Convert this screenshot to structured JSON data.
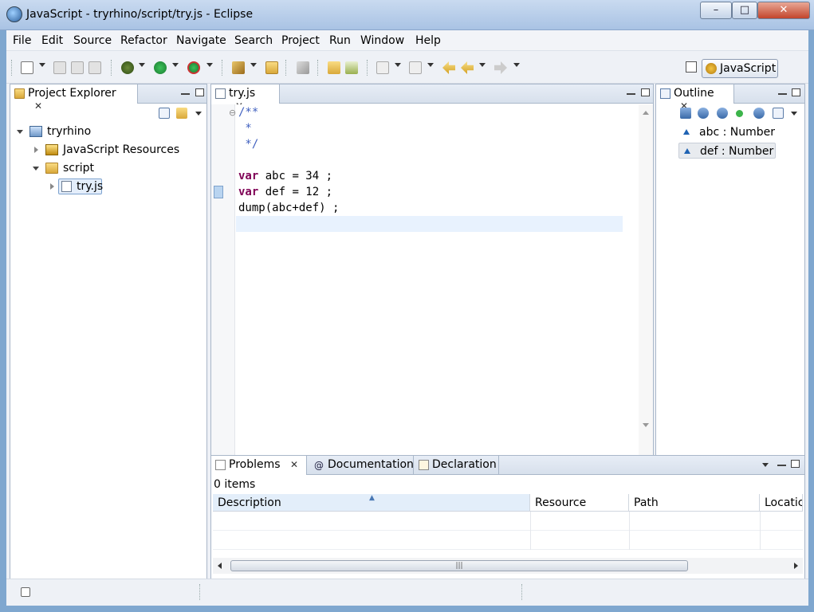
{
  "window": {
    "title": "JavaScript - tryrhino/script/try.js - Eclipse",
    "controls": {
      "minimize": "–",
      "maximize": "□",
      "close": "✕"
    }
  },
  "menu": [
    "File",
    "Edit",
    "Source",
    "Refactor",
    "Navigate",
    "Search",
    "Project",
    "Run",
    "Window",
    "Help"
  ],
  "perspective": {
    "label": "JavaScript"
  },
  "project_explorer": {
    "tab_label": "Project Explorer",
    "tree": [
      {
        "label": "tryrhino",
        "level": 0,
        "expanded": true,
        "icon": "project-icon"
      },
      {
        "label": "JavaScript Resources",
        "level": 1,
        "expanded": false,
        "icon": "js-resources-icon"
      },
      {
        "label": "script",
        "level": 1,
        "expanded": true,
        "icon": "folder-icon"
      },
      {
        "label": "try.js",
        "level": 2,
        "expanded": false,
        "icon": "js-file-icon",
        "selected": true
      }
    ]
  },
  "editor": {
    "tab_label": "try.js",
    "lines": [
      {
        "kind": "comment",
        "text": "/**"
      },
      {
        "kind": "comment",
        "text": " *"
      },
      {
        "kind": "comment",
        "text": " */"
      },
      {
        "kind": "blank",
        "text": ""
      },
      {
        "kind": "decl",
        "keyword": "var",
        "text": " abc = 34 ;"
      },
      {
        "kind": "decl",
        "keyword": "var",
        "text": " def = 12 ;"
      },
      {
        "kind": "code",
        "text": "dump(abc+def) ;"
      }
    ]
  },
  "outline": {
    "tab_label": "Outline",
    "items": [
      {
        "label": "abc : Number",
        "selected": false
      },
      {
        "label": "def : Number",
        "selected": true
      }
    ]
  },
  "bottom": {
    "tabs": [
      {
        "label": "Problems",
        "active": true,
        "icon": "problems-icon"
      },
      {
        "label": "Documentation",
        "active": false,
        "icon": "documentation-icon"
      },
      {
        "label": "Declaration",
        "active": false,
        "icon": "declaration-icon"
      }
    ],
    "items_count": "0 items",
    "columns": [
      "Description",
      "Resource",
      "Path",
      "Locatic"
    ]
  }
}
